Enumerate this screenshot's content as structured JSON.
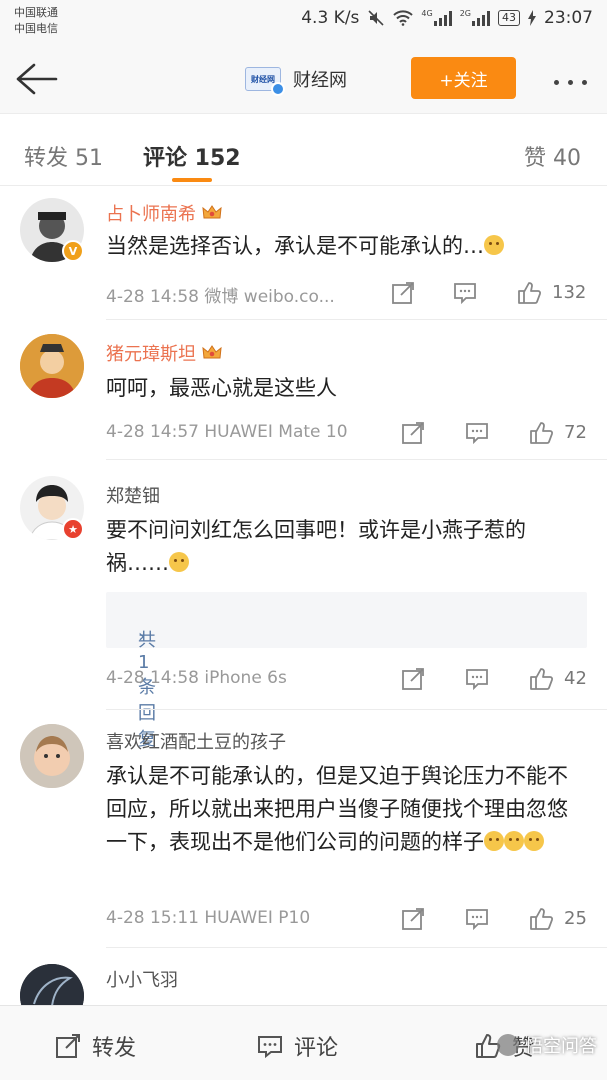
{
  "status_bar": {
    "carrier1": "中国联通",
    "carrier2": "中国电信",
    "speed": "4.3 K/s",
    "net1": "4G",
    "net2": "2G",
    "battery": "43",
    "time": "23:07"
  },
  "nav": {
    "logo_text": "财经网",
    "title": "财经网",
    "follow_label": "+关注"
  },
  "tabs": [
    {
      "label": "转发 51"
    },
    {
      "label": "评论 152"
    },
    {
      "label": "赞 40"
    }
  ],
  "comments": [
    {
      "name": "占卜师南希",
      "text": "当然是选择否认，承认是不可能承认的…",
      "time": "4-28 14:58",
      "source": "微博 weibo.co...",
      "likes": "132"
    },
    {
      "name": "猪元璋斯坦",
      "text": "呵呵，最恶心就是这些人",
      "time": "4-28 14:57",
      "source": "HUAWEI Mate 10",
      "likes": "72"
    },
    {
      "name": "郑楚钿",
      "text": "要不问问刘红怎么回事吧！或许是小燕子惹的祸……",
      "reply": "共1条回复",
      "time": "4-28 14:58",
      "source": "iPhone 6s",
      "likes": "42"
    },
    {
      "name": "喜欢红酒配土豆的孩子",
      "text": "承认是不可能承认的，但是又迫于舆论压力不能不回应，所以就出来把用户当傻子随便找个理由忽悠一下，表现出不是他们公司的问题的样子",
      "time": "4-28 15:11",
      "source": "HUAWEI P10",
      "likes": "25"
    },
    {
      "name": "小小飞羽"
    }
  ],
  "bottom_bar": {
    "repost": "转发",
    "comment": "评论",
    "like": "赞",
    "watermark": "悟空问答"
  },
  "colors": {
    "accent": "#fa8a12",
    "name_orange": "#eb7350",
    "link_blue": "#5a7ba6"
  }
}
